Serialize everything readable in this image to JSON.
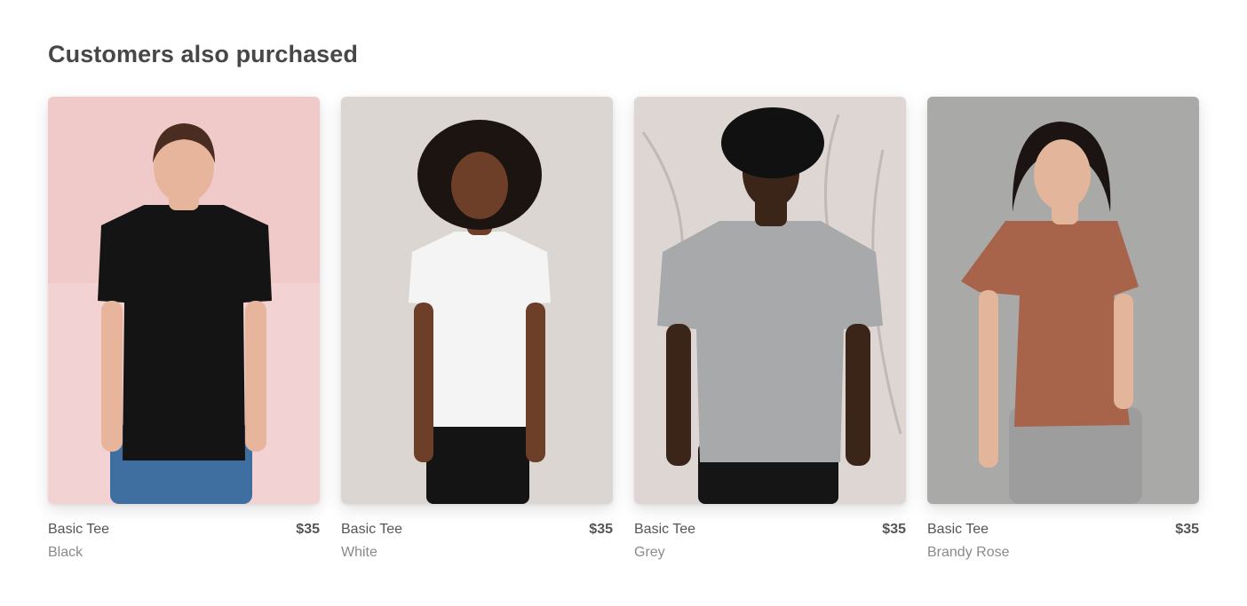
{
  "section": {
    "title": "Customers also purchased"
  },
  "products": [
    {
      "name": "Basic Tee",
      "price": "$35",
      "color": "Black",
      "bg": "#f0c9c9",
      "shirt": "#141414",
      "skin": "#e6b59c",
      "hair": "#4a2c20",
      "pants": "#3f6ea0"
    },
    {
      "name": "Basic Tee",
      "price": "$35",
      "color": "White",
      "bg": "#dcd6d3",
      "shirt": "#f4f4f4",
      "skin": "#6e3f28",
      "hair": "#1b1410",
      "pants": "#141414"
    },
    {
      "name": "Basic Tee",
      "price": "$35",
      "color": "Grey",
      "bg": "#ddd6d3",
      "shirt": "#a7a9aa",
      "skin": "#3b2418",
      "hair": "#111111",
      "pants": "#151515"
    },
    {
      "name": "Basic Tee",
      "price": "$35",
      "color": "Brandy Rose",
      "bg": "#a9a9a7",
      "shirt": "#a8644b",
      "skin": "#e3b59a",
      "hair": "#1c1412",
      "pants": "#9d9d9d"
    }
  ]
}
